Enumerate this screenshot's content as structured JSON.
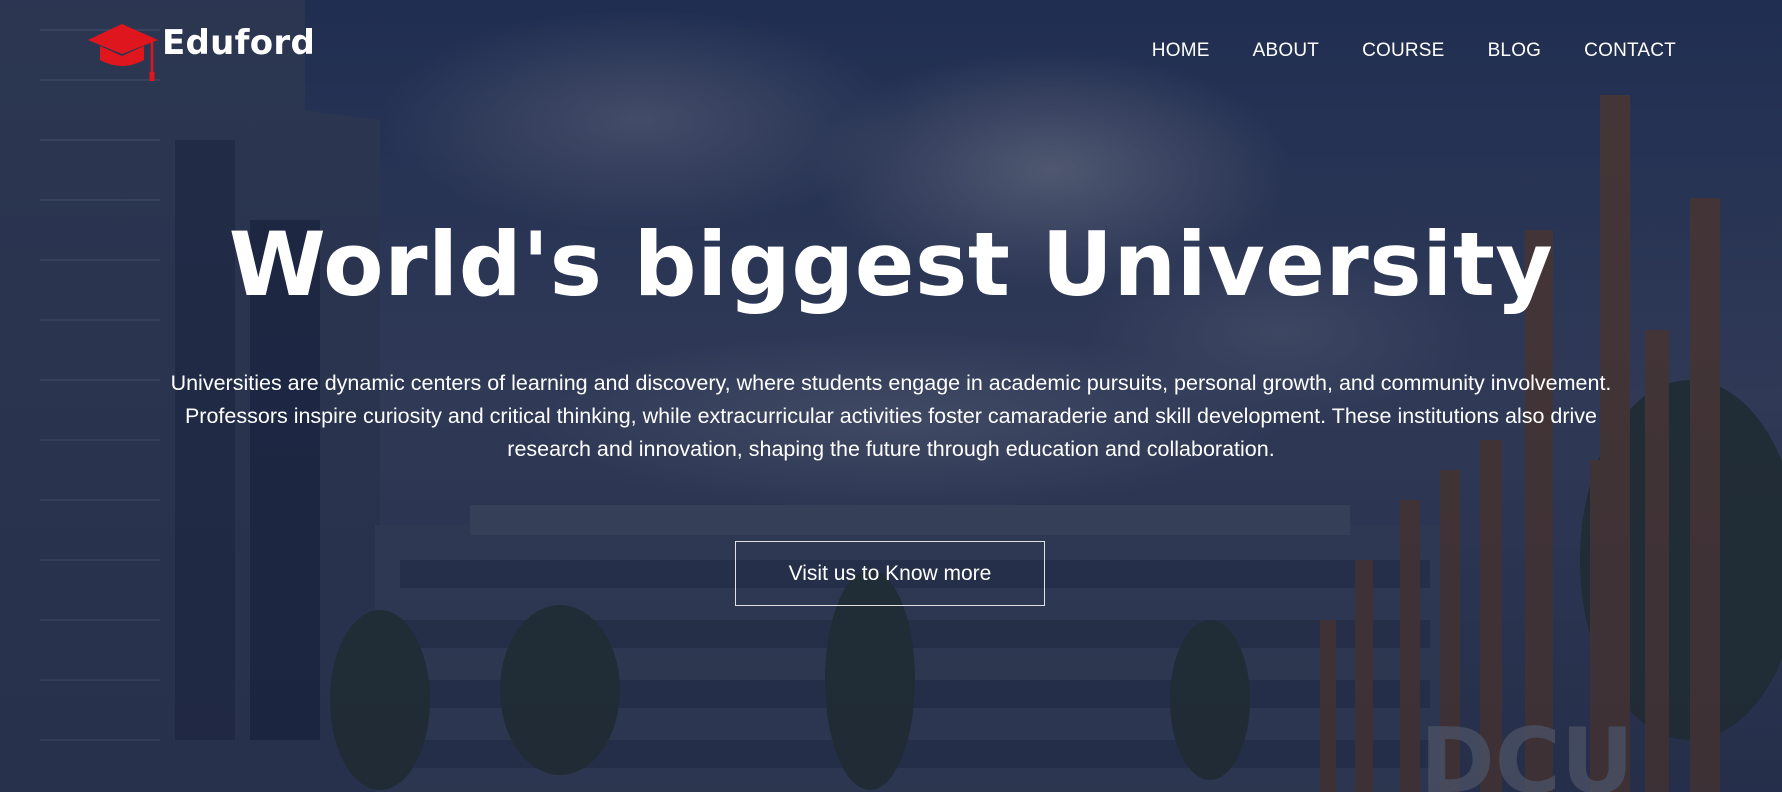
{
  "brand": {
    "name": "Eduford",
    "icon": "graduation-cap-icon",
    "accent_color": "#e0161e"
  },
  "nav": {
    "items": [
      {
        "label": "HOME"
      },
      {
        "label": "ABOUT"
      },
      {
        "label": "COURSE"
      },
      {
        "label": "BLOG"
      },
      {
        "label": "CONTACT"
      }
    ]
  },
  "hero": {
    "title": "World's biggest University",
    "description_lines": [
      "Universities are dynamic centers of learning and discovery, where students engage in academic pursuits, personal growth, and community involvement.",
      "Professors inspire curiosity and critical thinking, while extracurricular activities foster camaraderie and skill development. These institutions also drive",
      "research and innovation, shaping the future through education and collaboration."
    ],
    "cta_label": "Visit us to Know more"
  }
}
